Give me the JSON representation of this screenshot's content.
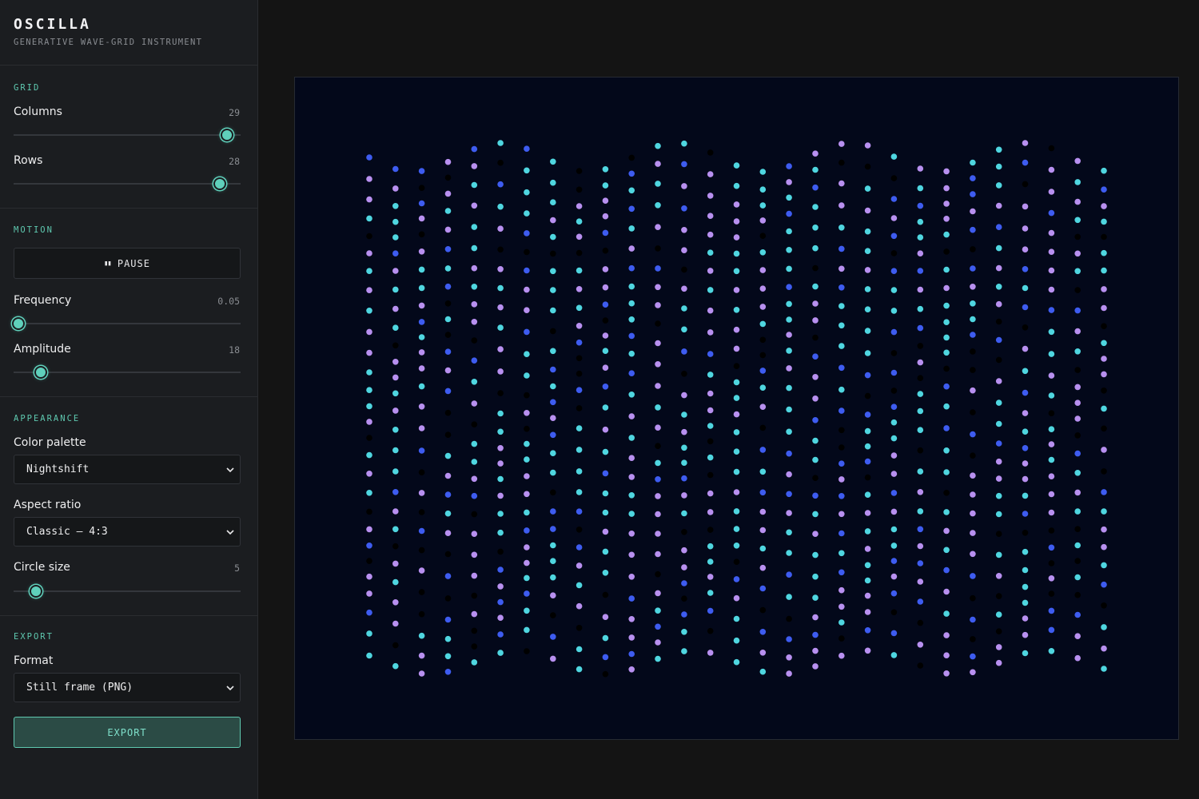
{
  "app": {
    "title": "OSCILLA",
    "subtitle": "GENERATIVE WAVE-GRID INSTRUMENT"
  },
  "grid": {
    "section_title": "GRID",
    "columns": {
      "label": "Columns",
      "value": "29",
      "level": 0.94
    },
    "rows": {
      "label": "Rows",
      "value": "28",
      "level": 0.91
    }
  },
  "motion": {
    "section_title": "MOTION",
    "pause_icon": "pause-icon",
    "pause_label": "PAUSE",
    "frequency": {
      "label": "Frequency",
      "value": "0.05",
      "level": 0.02
    },
    "amplitude": {
      "label": "Amplitude",
      "value": "18",
      "level": 0.12
    }
  },
  "appearance": {
    "section_title": "APPEARANCE",
    "palette_label": "Color palette",
    "palette_value": "Nightshift",
    "aspect_label": "Aspect ratio",
    "aspect_value": "Classic — 4:3",
    "circle_label": "Circle size",
    "circle_value": "5",
    "circle_level": 0.1
  },
  "export": {
    "section_title": "EXPORT",
    "format_label": "Format",
    "format_value": "Still frame (PNG)",
    "export_label": "EXPORT"
  },
  "canvas": {
    "columns": 29,
    "rows": 28,
    "amplitude": 18,
    "frequency": 0.05,
    "palette": [
      "#3e5cf0",
      "#b890f0",
      "#4fd6e0"
    ],
    "background": "#03081a"
  },
  "colors": {
    "accent": "#5fc9b0",
    "sidebar_bg": "#1b1d20",
    "stage_bg": "#141414"
  }
}
